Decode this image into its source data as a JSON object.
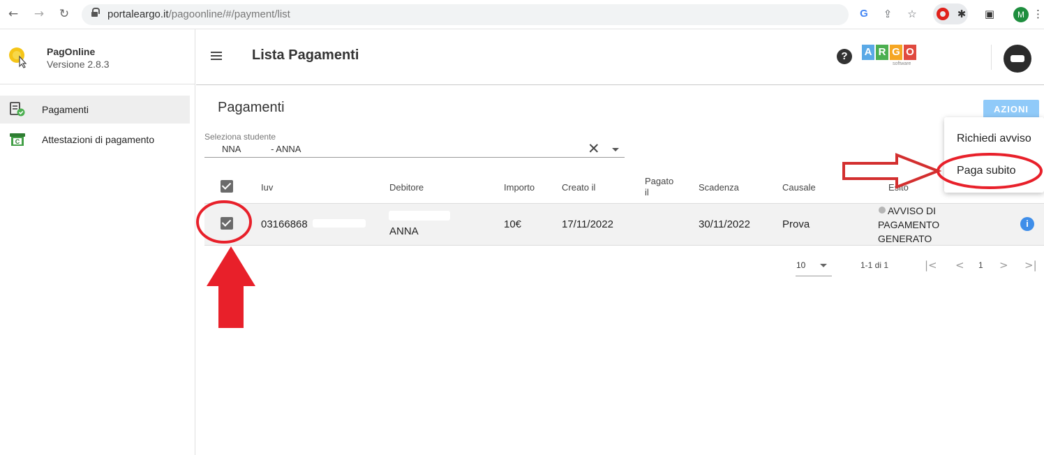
{
  "browser": {
    "url_domain": "portaleargo.it",
    "url_path": "/pagoonline/#/payment/list",
    "profile_initial": "M"
  },
  "sidebar": {
    "app_name": "PagOnline",
    "app_version": "Versione 2.8.3",
    "items": [
      {
        "label": "Pagamenti",
        "icon": "receipt-check-icon",
        "active": true
      },
      {
        "label": "Attestazioni di pagamento",
        "icon": "certificate-icon",
        "active": false
      }
    ]
  },
  "header": {
    "title": "Lista Pagamenti",
    "help_icon": "?",
    "logo_letters": [
      "A",
      "R",
      "G",
      "O"
    ],
    "logo_colors": [
      "#5aa9e6",
      "#4caf50",
      "#f5a623",
      "#e04a3f"
    ],
    "logo_subtext": "software"
  },
  "main": {
    "section_title": "Pagamenti",
    "actions_label": "AZIONI",
    "student_select": {
      "label": "Seleziona studente",
      "value": "NNA            - ANNA"
    },
    "table": {
      "columns": [
        "Iuv",
        "Debitore",
        "Importo",
        "Creato il",
        "Pagato il",
        "Scadenza",
        "Causale",
        "Esito"
      ],
      "rows": [
        {
          "selected": true,
          "iuv": "03166868",
          "debitore": "ANNA",
          "importo": "10€",
          "creato_il": "17/11/2022",
          "pagato_il": "",
          "scadenza": "30/11/2022",
          "causale": "Prova",
          "esito_lines": [
            "AVVISO DI",
            "PAGAMENTO",
            "GENERATO"
          ]
        }
      ]
    },
    "pagination": {
      "page_size": "10",
      "range": "1-1 di 1",
      "current_page": "1"
    }
  },
  "actions_menu": {
    "items": [
      "Richiedi avviso",
      "Paga subito"
    ]
  },
  "colors": {
    "accent_button": "#90caf9",
    "annotation_red": "#e8202a",
    "info_blue": "#3f8ee9"
  }
}
